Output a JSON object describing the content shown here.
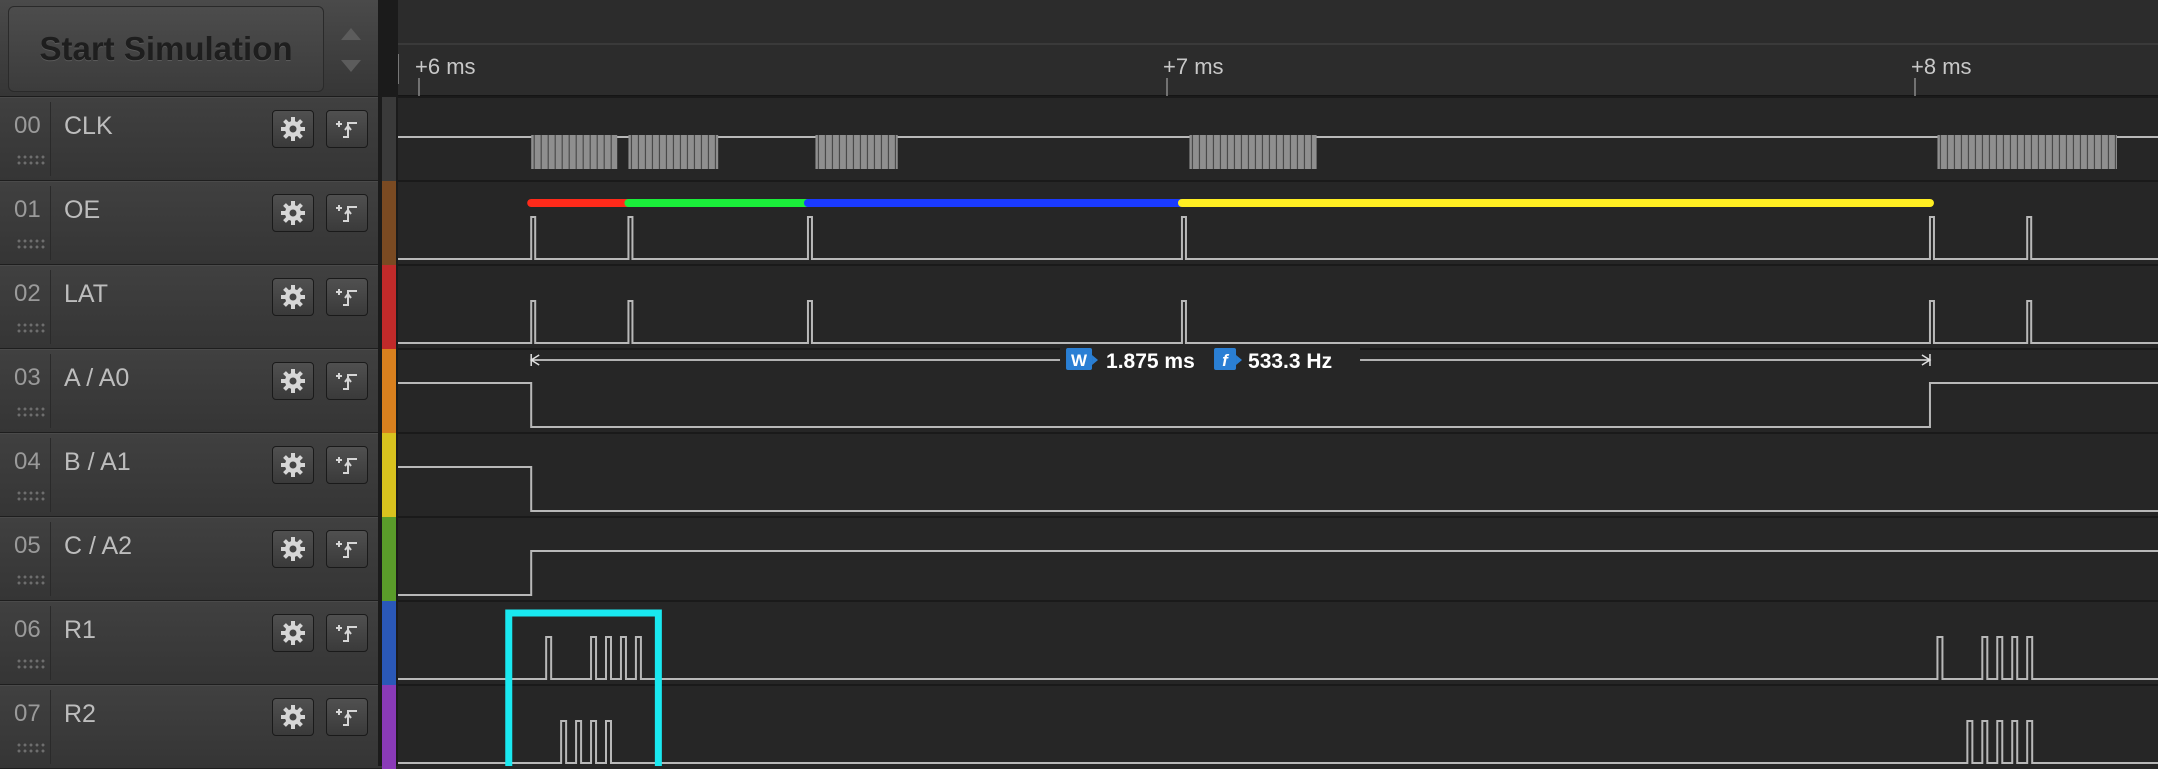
{
  "toolbar": {
    "start_simulation_label": "Start Simulation"
  },
  "timeline": {
    "ticks": [
      {
        "label": "+6 ms",
        "time_ms": 6.0
      },
      {
        "label": "+7 ms",
        "time_ms": 7.0
      },
      {
        "label": "+8 ms",
        "time_ms": 8.0
      }
    ]
  },
  "channels": [
    {
      "index": "00",
      "name": "CLK",
      "color": "#3a3a3a",
      "levels": [
        [
          5.0,
          0
        ],
        [
          6.15,
          1
        ],
        [
          6.25,
          0
        ],
        [
          6.25,
          1
        ],
        [
          6.43,
          0
        ],
        [
          6.55,
          1
        ],
        [
          6.66,
          0
        ],
        [
          6.86,
          1
        ],
        [
          6.95,
          0
        ],
        [
          6.95,
          0
        ],
        [
          8.03,
          1
        ],
        [
          8.27,
          0
        ]
      ]
    },
    {
      "index": "01",
      "name": "OE",
      "color": "#7a4a22",
      "pulses": [
        6.15,
        6.28,
        6.52,
        7.02,
        8.02,
        8.15
      ]
    },
    {
      "index": "02",
      "name": "LAT",
      "color": "#c12a2a",
      "pulses": [
        6.15,
        6.28,
        6.52,
        7.02,
        8.02,
        8.15
      ]
    },
    {
      "index": "03",
      "name": "A / A0",
      "color": "#d9801e",
      "steps": [
        {
          "t": 5.0,
          "v": 1
        },
        {
          "t": 6.15,
          "v": 0
        },
        {
          "t": 8.02,
          "v": 1
        }
      ]
    },
    {
      "index": "04",
      "name": "B / A1",
      "color": "#d8c21e",
      "steps": [
        {
          "t": 5.0,
          "v": 1
        },
        {
          "t": 6.15,
          "v": 0
        }
      ]
    },
    {
      "index": "05",
      "name": "C / A2",
      "color": "#5a9c2a",
      "steps": [
        {
          "t": 5.0,
          "v": 0
        },
        {
          "t": 6.15,
          "v": 1
        }
      ]
    },
    {
      "index": "06",
      "name": "R1",
      "color": "#2a58b8",
      "pulses": [
        6.17,
        6.23,
        6.25,
        6.27,
        6.29,
        8.03,
        8.09,
        8.11,
        8.13,
        8.15
      ]
    },
    {
      "index": "07",
      "name": "R2",
      "color": "#8a3ab8",
      "pulses": [
        6.19,
        6.21,
        6.23,
        6.25,
        8.07,
        8.09,
        8.11,
        8.13,
        8.15
      ]
    }
  ],
  "oe_segments": [
    {
      "color": "#ff2a1a",
      "start_ms": 6.15,
      "end_ms": 6.28
    },
    {
      "color": "#1aee3a",
      "start_ms": 6.28,
      "end_ms": 6.52
    },
    {
      "color": "#1a3aff",
      "start_ms": 6.52,
      "end_ms": 7.02
    },
    {
      "color": "#ffee22",
      "start_ms": 7.02,
      "end_ms": 8.02
    }
  ],
  "measurement": {
    "width_badge": "W",
    "width_value": "1.875 ms",
    "freq_badge": "f",
    "freq_value": "533.3 Hz",
    "start_ms": 6.15,
    "end_ms": 8.02
  },
  "highlight": {
    "color": "#19e8f0",
    "start_ms": 6.12,
    "end_ms": 6.32
  },
  "colors": {
    "background": "#262626",
    "waveform": "#b8b8b8",
    "badge": "#2a7fd4"
  }
}
